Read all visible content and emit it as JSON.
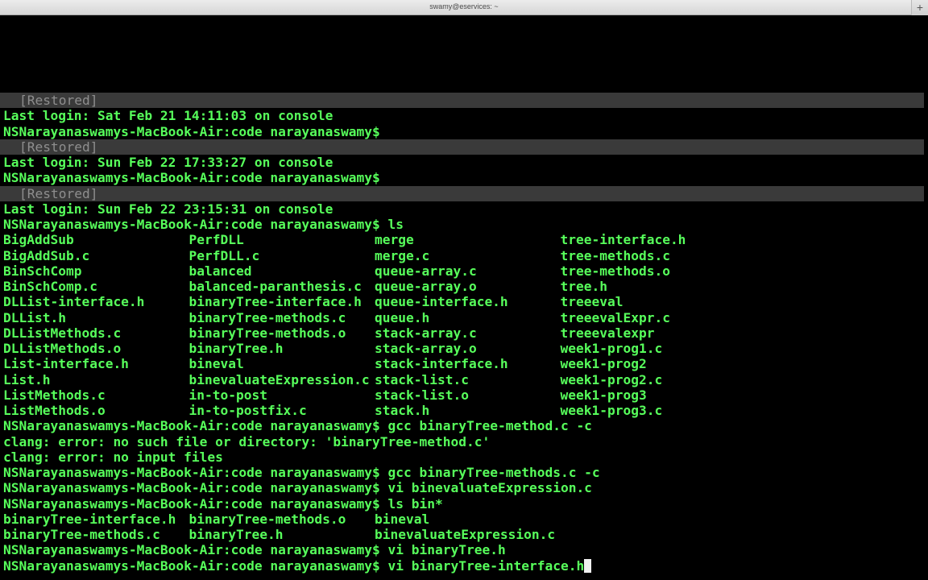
{
  "window": {
    "title": "swamy@eservices: ~",
    "new_tab_label": "+"
  },
  "terminal": {
    "prompt": "NSNarayanaswamys-MacBook-Air:code narayanaswamy$",
    "restored_label": "[Restored]",
    "sessions": [
      "Last login: Sat Feb 21 14:11:03 on console",
      "Last login: Sun Feb 22 17:33:27 on console",
      "Last login: Sun Feb 22 23:15:31 on console"
    ],
    "cmd_ls": " ls",
    "ls_listing": [
      [
        "BigAddSub",
        "PerfDLL",
        "merge",
        "tree-interface.h"
      ],
      [
        "BigAddSub.c",
        "PerfDLL.c",
        "merge.c",
        "tree-methods.c"
      ],
      [
        "BinSchComp",
        "balanced",
        "queue-array.c",
        "tree-methods.o"
      ],
      [
        "BinSchComp.c",
        "balanced-paranthesis.c",
        "queue-array.o",
        "tree.h"
      ],
      [
        "DLList-interface.h",
        "binaryTree-interface.h",
        "queue-interface.h",
        "treeeval"
      ],
      [
        "DLList.h",
        "binaryTree-methods.c",
        "queue.h",
        "treeevalExpr.c"
      ],
      [
        "DLListMethods.c",
        "binaryTree-methods.o",
        "stack-array.c",
        "treeevalexpr"
      ],
      [
        "DLListMethods.o",
        "binaryTree.h",
        "stack-array.o",
        "week1-prog1.c"
      ],
      [
        "List-interface.h",
        "bineval",
        "stack-interface.h",
        "week1-prog2"
      ],
      [
        "List.h",
        "binevaluateExpression.c",
        "stack-list.c",
        "week1-prog2.c"
      ],
      [
        "ListMethods.c",
        "in-to-post",
        "stack-list.o",
        "week1-prog3"
      ],
      [
        "ListMethods.o",
        "in-to-postfix.c",
        "stack.h",
        "week1-prog3.c"
      ]
    ],
    "cmd_gcc1": " gcc binaryTree-method.c -c",
    "error1": "clang: error: no such file or directory: 'binaryTree-method.c'",
    "error2": "clang: error: no input files",
    "cmd_gcc2": " gcc binaryTree-methods.c -c",
    "cmd_vi1": " vi binevaluateExpression.c",
    "cmd_lsbin": " ls bin*",
    "lsbin_listing": [
      [
        "binaryTree-interface.h",
        "binaryTree-methods.o",
        "bineval"
      ],
      [
        "binaryTree-methods.c",
        "binaryTree.h",
        "binevaluateExpression.c"
      ]
    ],
    "cmd_vi2": " vi binaryTree.h",
    "cmd_vi3": " vi binaryTree-interface.h"
  },
  "colors": {
    "background": "#000000",
    "text": "#57ff5b",
    "restored_bar": "#3a3a3a",
    "restored_text": "#8e8e8e",
    "cursor": "#f0f0f0"
  }
}
